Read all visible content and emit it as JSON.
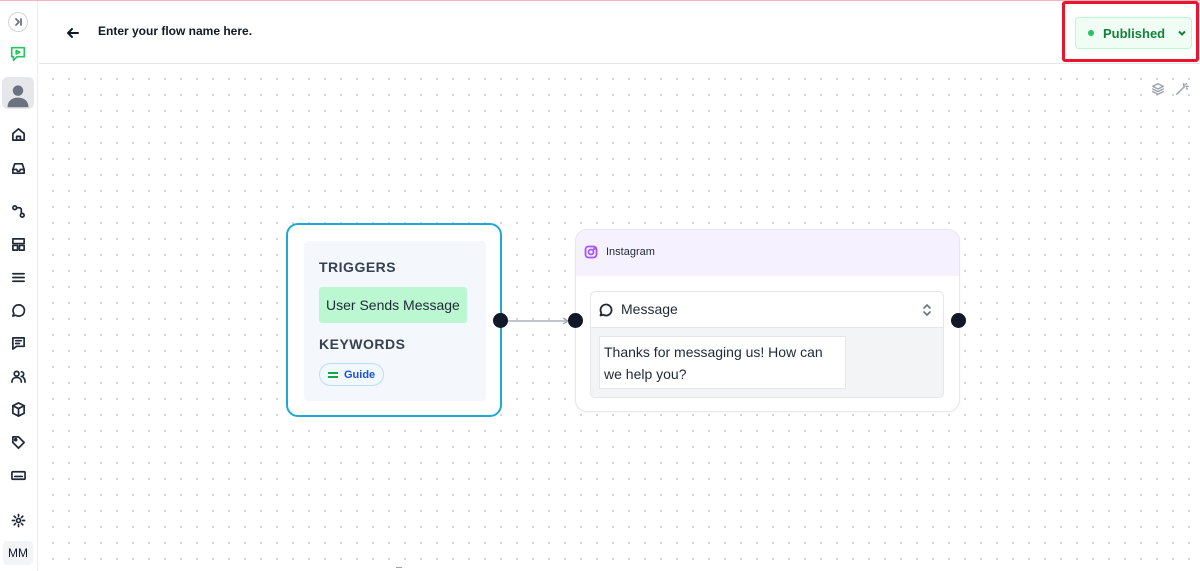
{
  "header": {
    "flow_name": "Enter your flow name here.",
    "status_label": "Published",
    "status_color": "#22c55e"
  },
  "sidebar": {
    "user_initials": "MM",
    "items": [
      "collapse-icon",
      "logo-icon",
      "avatar",
      "home-icon",
      "inbox-icon",
      "flows-icon",
      "layout-icon",
      "list-icon",
      "chat-icon",
      "messages-icon",
      "contacts-icon",
      "package-icon",
      "tag-icon",
      "keyboard-icon",
      "settings-icon"
    ]
  },
  "trigger_node": {
    "triggers_title": "TRIGGERS",
    "trigger": "User Sends Message",
    "keywords_title": "KEYWORDS",
    "keyword": "Guide"
  },
  "action_node": {
    "channel": "Instagram",
    "message_type": "Message",
    "message_text": "Thanks for messaging us! How can we help you?"
  },
  "colors": {
    "accent_border": "#1ea7d7",
    "highlight": "#e8152f",
    "trigger_chip": "#bbf7d0"
  }
}
